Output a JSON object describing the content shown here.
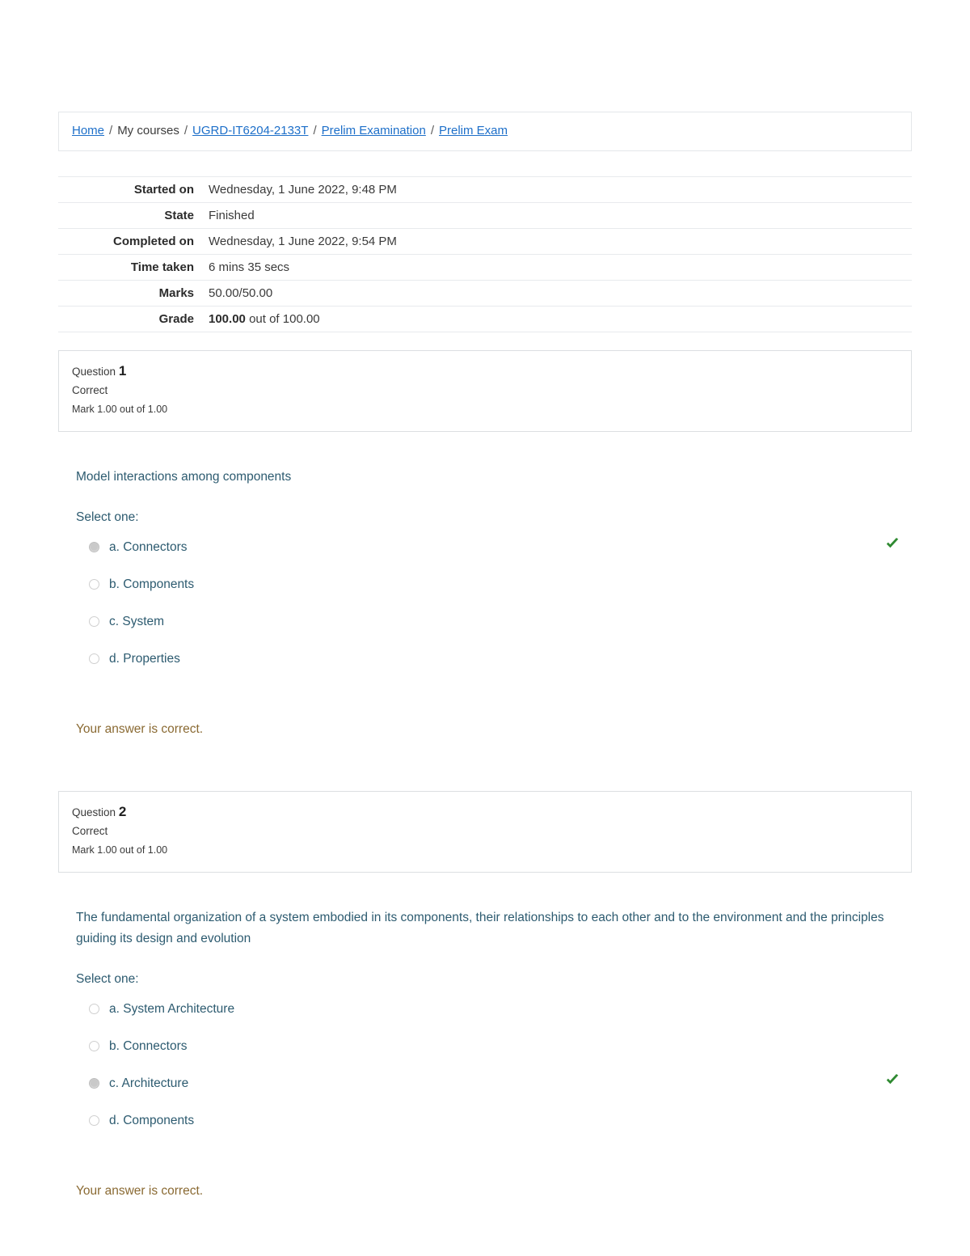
{
  "breadcrumb": {
    "items": [
      {
        "label": "Home",
        "link": true
      },
      {
        "label": "My courses",
        "link": false
      },
      {
        "label": "UGRD-IT6204-2133T",
        "link": true
      },
      {
        "label": "Prelim Examination",
        "link": true
      },
      {
        "label": "Prelim Exam",
        "link": true
      }
    ],
    "separator": "/"
  },
  "summary": {
    "rows": [
      {
        "label": "Started on",
        "value": "Wednesday, 1 June 2022, 9:48 PM"
      },
      {
        "label": "State",
        "value": "Finished"
      },
      {
        "label": "Completed on",
        "value": "Wednesday, 1 June 2022, 9:54 PM"
      },
      {
        "label": "Time taken",
        "value": "6 mins 35 secs"
      },
      {
        "label": "Marks",
        "value": "50.00/50.00"
      }
    ],
    "grade": {
      "label": "Grade",
      "value_strong": "100.00",
      "value_rest": "out of 100.00"
    }
  },
  "questions": [
    {
      "number_label": "Question",
      "number": "1",
      "state": "Correct",
      "grade": "Mark 1.00 out of 1.00",
      "text": "Model interactions among components",
      "select_label": "Select one:",
      "options": [
        {
          "label": "a. Connectors",
          "selected": true
        },
        {
          "label": "b. Components",
          "selected": false
        },
        {
          "label": "c. System",
          "selected": false
        },
        {
          "label": "d. Properties",
          "selected": false
        }
      ],
      "correct_option_index": 0,
      "feedback": "Your answer is correct."
    },
    {
      "number_label": "Question",
      "number": "2",
      "state": "Correct",
      "grade": "Mark 1.00 out of 1.00",
      "text": "The fundamental organization of a system embodied in its components, their relationships to each other and to the environment and the principles guiding its design and evolution",
      "select_label": "Select one:",
      "options": [
        {
          "label": "a. System Architecture",
          "selected": false
        },
        {
          "label": "b. Connectors",
          "selected": false
        },
        {
          "label": "c. Architecture",
          "selected": true
        },
        {
          "label": "d. Components",
          "selected": false
        }
      ],
      "correct_option_index": 2,
      "feedback": "Your answer is correct."
    }
  ],
  "colors": {
    "link": "#1d6fc9",
    "question_text": "#2d5b70",
    "feedback": "#8a6a33",
    "correct_tick": "#2f8a31"
  }
}
